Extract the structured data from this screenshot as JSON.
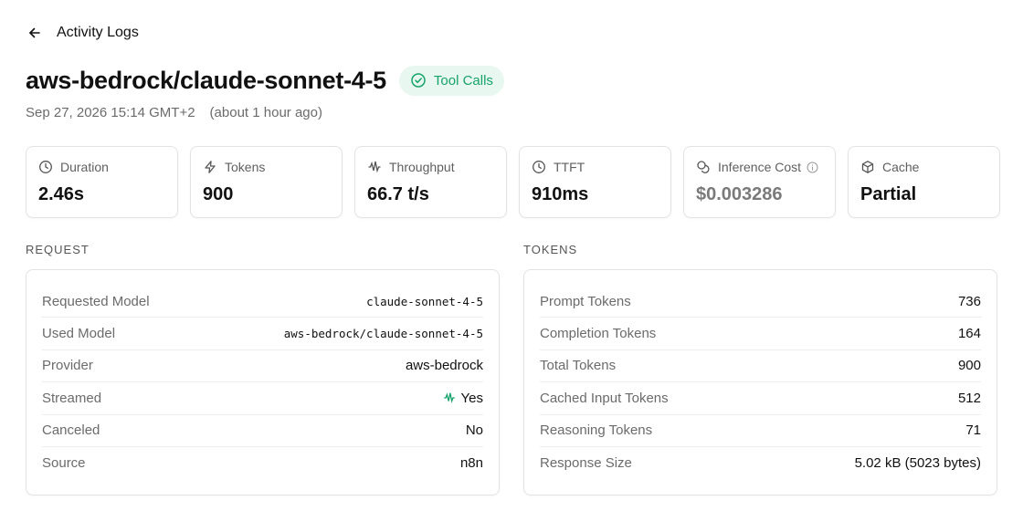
{
  "header": {
    "back_label": "Activity Logs"
  },
  "title": "aws-bedrock/claude-sonnet-4-5",
  "badge": {
    "label": "Tool Calls",
    "color": "#16a36a",
    "icon": "check-circle-icon"
  },
  "timestamp": {
    "date": "Sep 27, 2026 15:14 GMT+2",
    "relative": "(about 1 hour ago)"
  },
  "stats": [
    {
      "label": "Duration",
      "value": "2.46s",
      "icon": "clock-icon"
    },
    {
      "label": "Tokens",
      "value": "900",
      "icon": "lightning-icon"
    },
    {
      "label": "Throughput",
      "value": "66.7 t/s",
      "icon": "audio-waveform-icon"
    },
    {
      "label": "TTFT",
      "value": "910ms",
      "icon": "clock-icon"
    },
    {
      "label": "Inference Cost",
      "value": "$0.003286",
      "icon": "coins-icon"
    },
    {
      "label": "Cache",
      "value": "Partial",
      "icon": "box-icon"
    }
  ],
  "request": {
    "section_label": "REQUEST",
    "rows": [
      {
        "label": "Requested Model",
        "value": "claude-sonnet-4-5"
      },
      {
        "label": "Used Model",
        "value": "aws-bedrock/claude-sonnet-4-5"
      },
      {
        "label": "Provider",
        "value": "aws-bedrock"
      },
      {
        "label": "Streamed",
        "value": "Yes"
      },
      {
        "label": "Canceled",
        "value": "No"
      },
      {
        "label": "Source",
        "value": "n8n"
      }
    ]
  },
  "tokens": {
    "section_label": "TOKENS",
    "rows": [
      {
        "label": "Prompt Tokens",
        "value": "736"
      },
      {
        "label": "Completion Tokens",
        "value": "164"
      },
      {
        "label": "Total Tokens",
        "value": "900"
      },
      {
        "label": "Cached Input Tokens",
        "value": "512"
      },
      {
        "label": "Reasoning Tokens",
        "value": "71"
      },
      {
        "label": "Response Size",
        "value": "5.02 kB (5023 bytes)"
      }
    ]
  }
}
